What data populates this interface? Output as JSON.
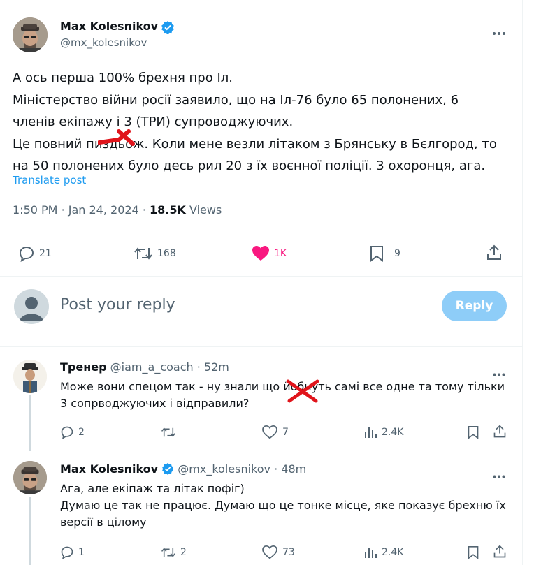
{
  "main_tweet": {
    "author_name": "Max Kolesnikov",
    "handle": "@mx_kolesnikov",
    "text_lines": [
      "А ось перша 100% брехня про Іл.",
      "Міністерство війни росії заявило, що на Іл-76 було 65 полонених, 6",
      "членів екіпажу і 3 (ТРИ) супроводжуючих.",
      "Це повний пиздьож. Коли мене везли літаком з Брянську в Бєлгород, то",
      "на 50 полонених було десь рил 20 з їх воєнної поліції. 3 охоронця, ага."
    ],
    "translate": "Translate post",
    "time": "1:50 PM",
    "date": "Jan 24, 2024",
    "views_count": "18.5K",
    "views_label": "Views",
    "replies": "21",
    "reposts": "168",
    "likes": "1K",
    "bookmarks": "9"
  },
  "reply_box": {
    "placeholder": "Post your reply",
    "button": "Reply"
  },
  "replies": [
    {
      "author_name": "Тренер",
      "handle": "@iam_a_coach",
      "time": "52m",
      "text_lines": [
        "Може вони спецом так - ну знали що йобнуть самі все одне та тому тільки",
        "3 сопрводжуючих і відправили?"
      ],
      "replies": "2",
      "reposts": "",
      "likes": "7",
      "views": "2.4K"
    },
    {
      "author_name": "Max Kolesnikov",
      "handle": "@mx_kolesnikov",
      "time": "48m",
      "text_lines": [
        "Ага, але екіпаж та літак пофіг)",
        "Думаю це так не працює. Думаю що це тонке місце, яке показує брехню їх",
        "версії в цілому"
      ],
      "replies": "1",
      "reposts": "2",
      "likes": "73",
      "views": "2.4K"
    }
  ],
  "colors": {
    "accent": "#1d9bf0",
    "like": "#f91880",
    "censor": "#e0141b",
    "muted": "#536471"
  }
}
